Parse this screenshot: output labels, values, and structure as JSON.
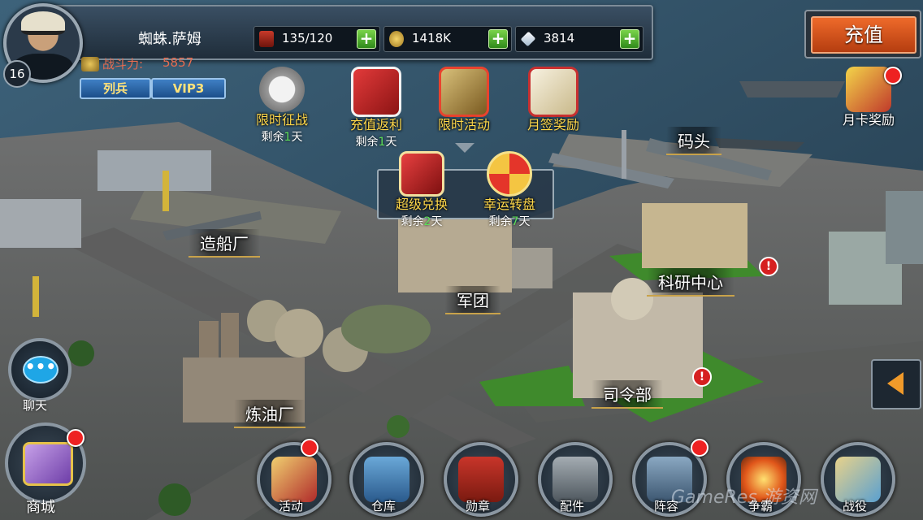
{
  "player": {
    "name": "蜘蛛.萨姆",
    "level": "16",
    "power_label": "战斗力:",
    "power_value": "5857",
    "rank": "列兵",
    "vip": "VIP3"
  },
  "resources": [
    {
      "icon": "fuel-barrel-icon",
      "value": "135/120"
    },
    {
      "icon": "gold-coin-icon",
      "value": "1418K"
    },
    {
      "icon": "diamond-icon",
      "value": "3814"
    }
  ],
  "recharge_label": "充值",
  "events": [
    {
      "id": "timed-battle",
      "label": "限时征战",
      "sub_prefix": "剩余",
      "sub_num": "1",
      "sub_suffix": "天"
    },
    {
      "id": "recharge-rebate",
      "label": "充值返利",
      "sub_prefix": "剩余",
      "sub_num": "1",
      "sub_suffix": "天"
    },
    {
      "id": "timed-activity",
      "label": "限时活动"
    },
    {
      "id": "monthly-signin",
      "label": "月签奖励"
    },
    {
      "id": "monthly-card",
      "label": "月卡奖励"
    }
  ],
  "popup": [
    {
      "label": "超级兑换",
      "sub_prefix": "剩余",
      "sub_num": "2",
      "sub_suffix": "天"
    },
    {
      "label": "幸运转盘",
      "sub_prefix": "剩余",
      "sub_num": "7",
      "sub_suffix": "天"
    }
  ],
  "buildings": {
    "shipyard": "造船厂",
    "dock": "码头",
    "legion": "军团",
    "research": "科研中心",
    "hq": "司令部",
    "refinery": "炼油厂"
  },
  "chat_label": "聊天",
  "shop_label": "商城",
  "bottom_menu": [
    {
      "label": "活动",
      "icon": "bugle-icon",
      "dot": true
    },
    {
      "label": "仓库",
      "icon": "warehouse-icon",
      "dot": false
    },
    {
      "label": "勋章",
      "icon": "medal-icon",
      "dot": false
    },
    {
      "label": "配件",
      "icon": "turret-icon",
      "dot": false
    },
    {
      "label": "阵容",
      "icon": "battleship-icon",
      "dot": true
    },
    {
      "label": "争霸",
      "icon": "explosion-icon",
      "dot": false
    },
    {
      "label": "战役",
      "icon": "map-icon",
      "dot": false
    }
  ],
  "watermark": "GameRes 游资网",
  "colors": {
    "gold": "#ffd84a",
    "green": "#5ee05a",
    "red": "#e22222",
    "recharge": "#ee6a2a"
  }
}
